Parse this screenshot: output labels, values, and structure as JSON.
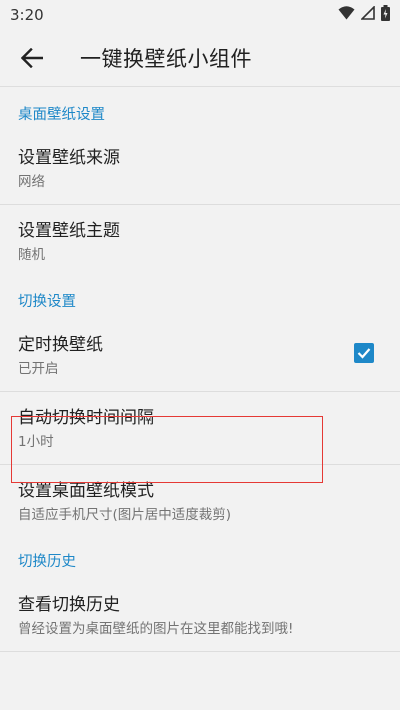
{
  "status_bar": {
    "time": "3:20",
    "icons": [
      "wifi-icon",
      "signal-icon",
      "battery-icon"
    ]
  },
  "toolbar": {
    "back_icon": "arrow-left-icon",
    "title": "一键换壁纸小组件"
  },
  "sections": [
    {
      "header": "桌面壁纸设置",
      "items": [
        {
          "title": "设置壁纸来源",
          "summary": "网络"
        },
        {
          "title": "设置壁纸主题",
          "summary": "随机"
        }
      ]
    },
    {
      "header": "切换设置",
      "items": [
        {
          "title": "定时换壁纸",
          "summary": "已开启",
          "checked": true
        },
        {
          "title": "自动切换时间间隔",
          "summary": "1小时"
        },
        {
          "title": "设置桌面壁纸模式",
          "summary": "自适应手机尺寸(图片居中适度裁剪)"
        }
      ]
    },
    {
      "header": "切换历史",
      "items": [
        {
          "title": "查看切换历史",
          "summary": "曾经设置为桌面壁纸的图片在这里都能找到哦!"
        }
      ]
    }
  ],
  "colors": {
    "accent": "#1e88c8",
    "highlight": "#e53935",
    "background": "#f2f2f2"
  }
}
